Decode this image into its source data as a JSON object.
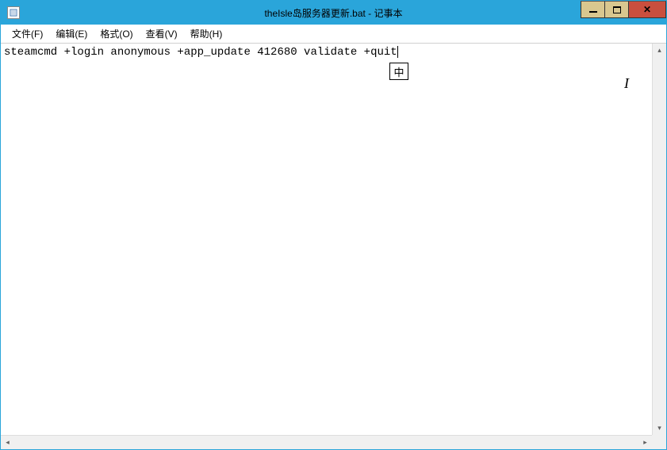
{
  "window": {
    "title": "theIsle岛服务器更新.bat - 记事本"
  },
  "menubar": {
    "items": [
      {
        "label": "文件(F)"
      },
      {
        "label": "编辑(E)"
      },
      {
        "label": "格式(O)"
      },
      {
        "label": "查看(V)"
      },
      {
        "label": "帮助(H)"
      }
    ]
  },
  "editor": {
    "content": "steamcmd +login anonymous +app_update 412680 validate +quit"
  },
  "ime": {
    "label": "中"
  },
  "scrollbar": {
    "up": "▴",
    "down": "▾",
    "left": "◂",
    "right": "▸"
  }
}
